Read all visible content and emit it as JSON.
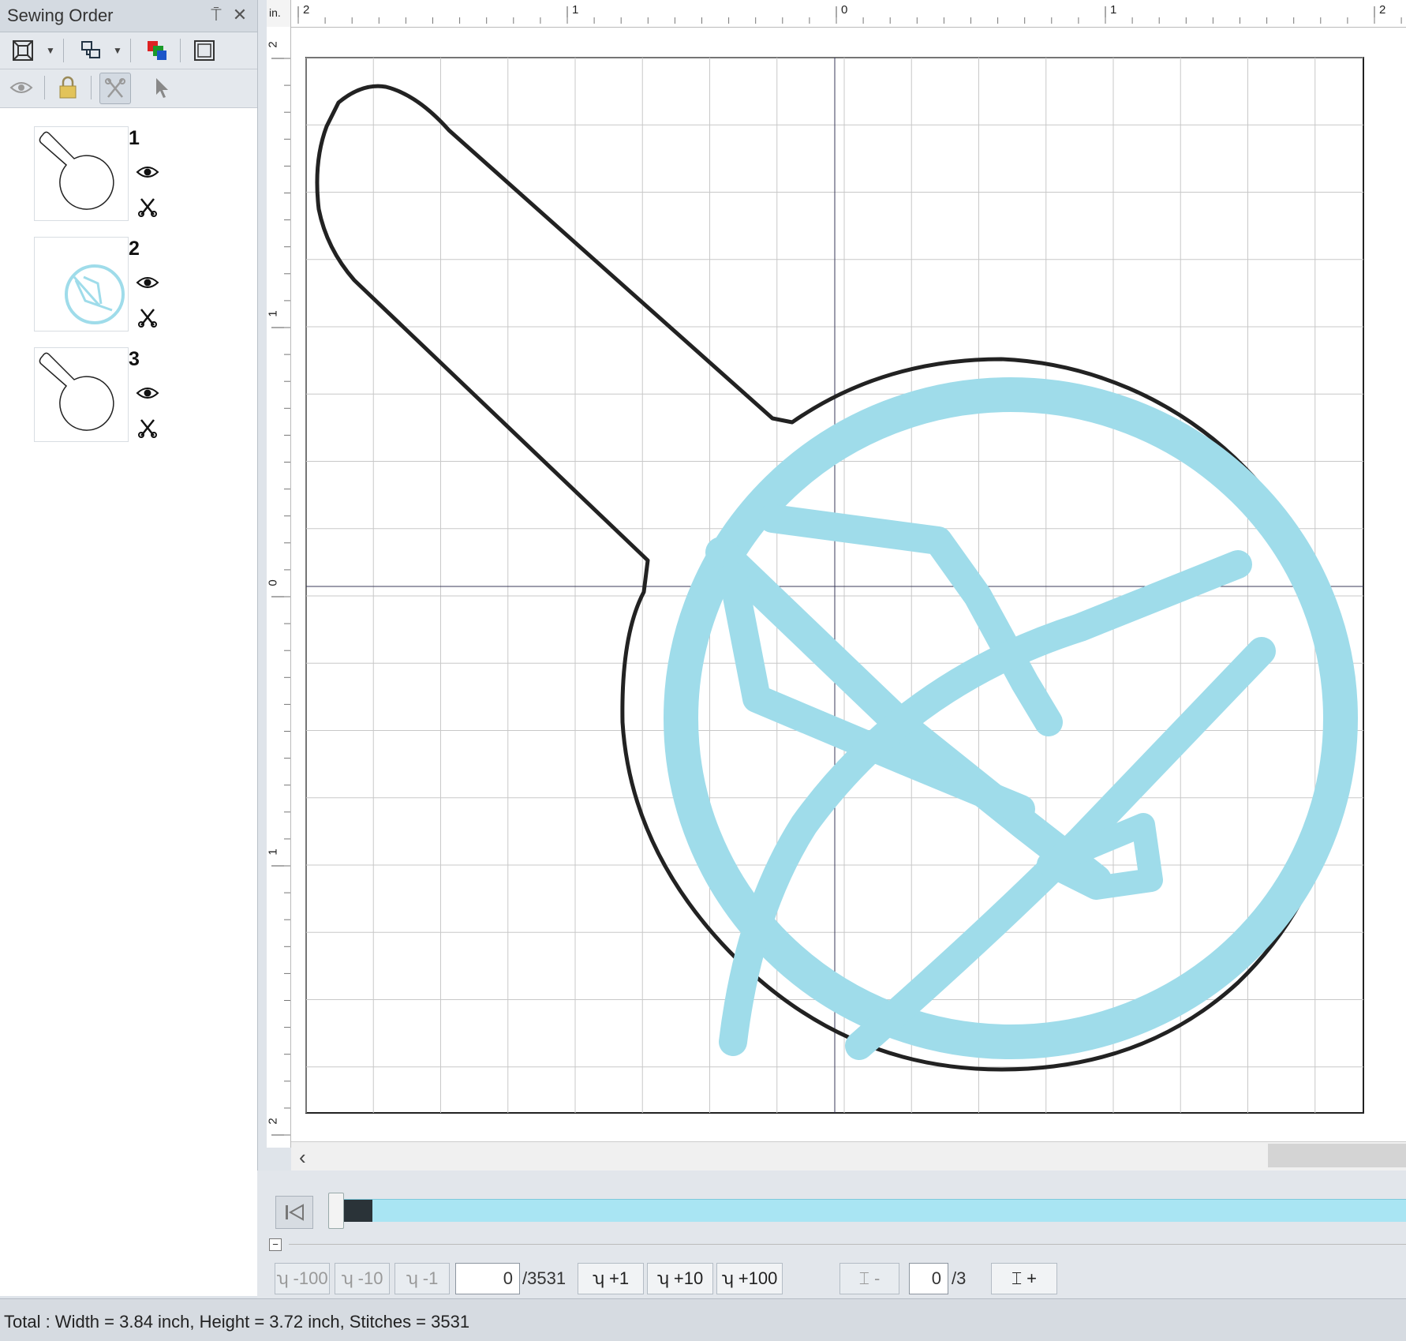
{
  "panel": {
    "title": "Sewing Order",
    "pin_glyph": "⍑",
    "close_glyph": "✕",
    "toolbar1": [
      "fit-view-icon",
      "group-icon",
      "color-sort-icon",
      "frame-icon"
    ],
    "toolbar2": [
      "visibility-icon",
      "lock-icon",
      "scissors-icon",
      "pointer-icon"
    ],
    "items": [
      {
        "number": "1",
        "thumb": "tag-outline",
        "visible_icon": "eye-icon",
        "cut_icon": "scissors-icon"
      },
      {
        "number": "2",
        "thumb": "blue-emblem",
        "visible_icon": "eye-icon",
        "cut_icon": "scissors-icon"
      },
      {
        "number": "3",
        "thumb": "tag-outline",
        "visible_icon": "eye-icon",
        "cut_icon": "scissors-icon"
      }
    ]
  },
  "ruler": {
    "unit": "in.",
    "top_labels": [
      "2",
      "1",
      "0",
      "1",
      "2"
    ],
    "left_labels": [
      "2",
      "1",
      "0",
      "1",
      "2"
    ]
  },
  "canvas": {
    "outline_color": "#222222",
    "stitch_color": "#9fdcea",
    "grid_color": "#c8c8c8"
  },
  "progress": {
    "fraction": 0.034,
    "fill_color": "#2a3338",
    "track_color": "#a9e5f3"
  },
  "stitch_controls": {
    "minus100": "-100",
    "minus10": "-10",
    "minus1": "-1",
    "stitch_value": "0",
    "stitch_total": "/3531",
    "plus1": "+1",
    "plus10": "+10",
    "plus100": "+100",
    "color_minus": "-",
    "color_value": "0",
    "color_total": "/3",
    "color_plus": "+"
  },
  "status": {
    "text": "Total : Width = 3.84 inch, Height = 3.72 inch, Stitches = 3531"
  }
}
